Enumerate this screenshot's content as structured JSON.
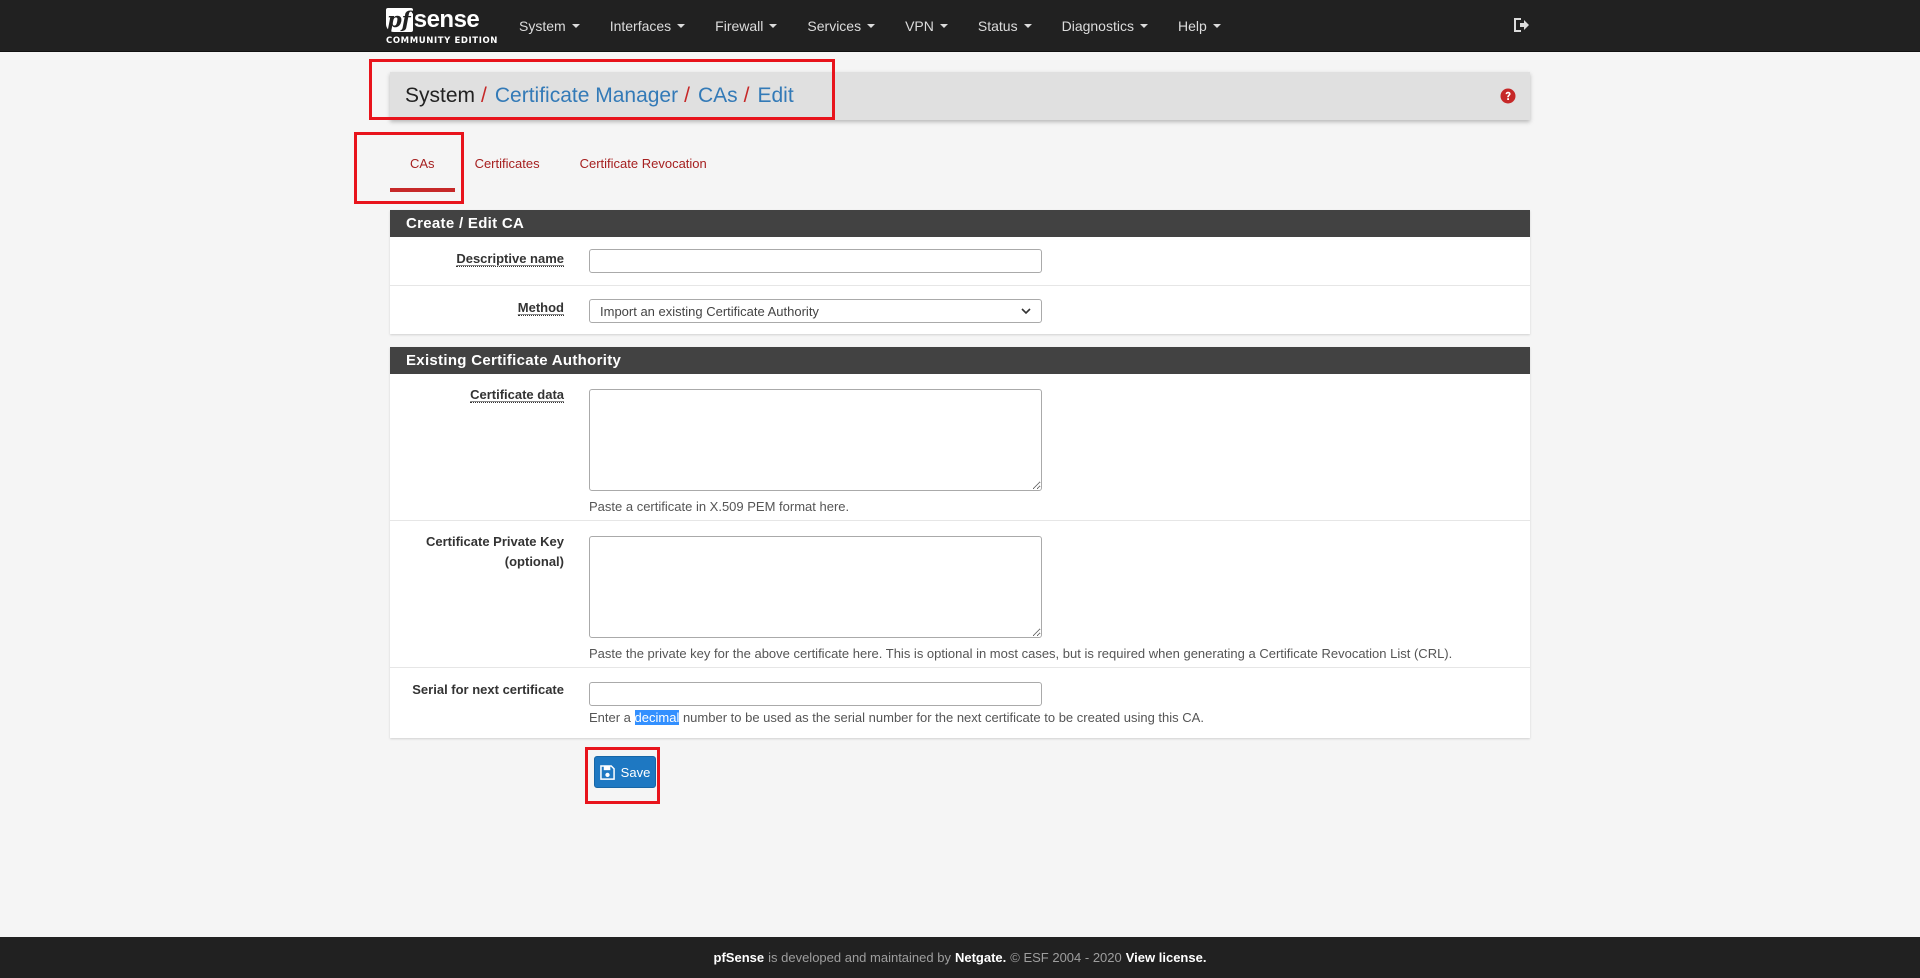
{
  "brand": {
    "logo_pf": "pf",
    "logo_sense": "sense",
    "edition": "COMMUNITY EDITION"
  },
  "nav": {
    "items": [
      {
        "label": "System"
      },
      {
        "label": "Interfaces"
      },
      {
        "label": "Firewall"
      },
      {
        "label": "Services"
      },
      {
        "label": "VPN"
      },
      {
        "label": "Status"
      },
      {
        "label": "Diagnostics"
      },
      {
        "label": "Help"
      }
    ],
    "logout_icon": "sign-out-icon"
  },
  "breadcrumb": {
    "items": [
      {
        "label": "System"
      },
      {
        "label": "Certificate Manager"
      },
      {
        "label": "CAs"
      },
      {
        "label": "Edit"
      }
    ],
    "separator": "/",
    "help_icon": "question-circle-icon"
  },
  "tabs": [
    {
      "label": "CAs",
      "active": true
    },
    {
      "label": "Certificates",
      "active": false
    },
    {
      "label": "Certificate Revocation",
      "active": false
    }
  ],
  "create_panel": {
    "heading": "Create / Edit CA",
    "descriptive_name": {
      "label": "Descriptive name",
      "value": ""
    },
    "method": {
      "label": "Method",
      "selected": "Import an existing Certificate Authority"
    }
  },
  "existing_panel": {
    "heading": "Existing Certificate Authority",
    "cert_data": {
      "label": "Certificate data",
      "value": "",
      "help": "Paste a certificate in X.509 PEM format here."
    },
    "private_key": {
      "label_line1": "Certificate Private Key",
      "label_line2": "(optional)",
      "value": "",
      "help": "Paste the private key for the above certificate here. This is optional in most cases, but is required when generating a Certificate Revocation List (CRL)."
    },
    "serial": {
      "label": "Serial for next certificate",
      "value": "",
      "help_before": "Enter a ",
      "help_selected": "decimal",
      "help_after": " number to be used as the serial number for the next certificate to be created using this CA."
    }
  },
  "save_button": {
    "label": "Save",
    "icon": "floppy-disk-icon"
  },
  "footer": {
    "product": "pfSense",
    "text1": "is developed and maintained by",
    "company": "Netgate.",
    "text2": "© ESF 2004 - 2020",
    "license": "View license."
  },
  "colors": {
    "navbar_bg": "#212121",
    "panel_heading_bg": "#424242",
    "tab_red": "#a62020",
    "link_blue": "#337ab7",
    "save_blue": "#1e78c2",
    "highlight_red": "#e8141c"
  }
}
